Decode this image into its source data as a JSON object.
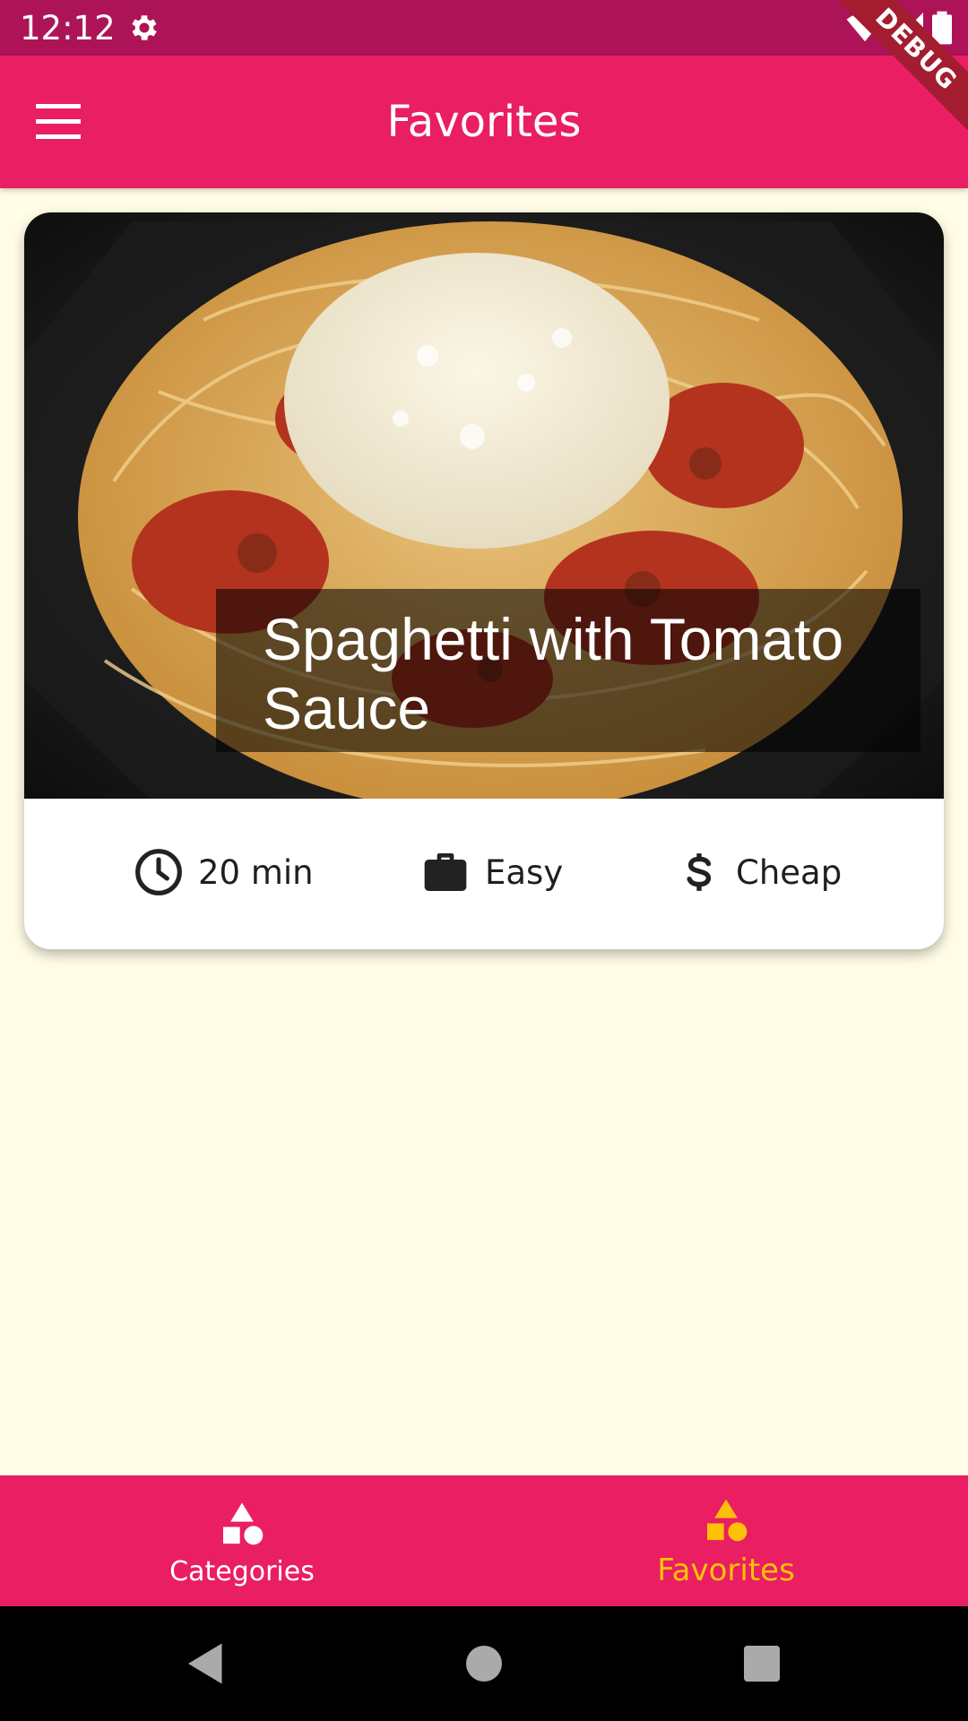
{
  "status_bar": {
    "time": "12:12",
    "icons": [
      "gear-icon",
      "wifi-icon",
      "signal-icon",
      "battery-icon"
    ]
  },
  "debug_banner": "DEBUG",
  "app_bar": {
    "title": "Favorites",
    "menu_icon": "menu-icon"
  },
  "meal_card": {
    "title": "Spaghetti with Tomato Sauce",
    "image_icon": "spaghetti-photo",
    "duration": "20 min",
    "complexity": "Easy",
    "affordability": "Cheap",
    "duration_icon": "clock-icon",
    "complexity_icon": "briefcase-icon",
    "affordability_icon": "dollar-icon"
  },
  "bottom_nav": {
    "items": [
      {
        "label": "Categories",
        "icon": "category-icon",
        "active": false
      },
      {
        "label": "Favorites",
        "icon": "category-icon",
        "active": true
      }
    ]
  },
  "system_nav": [
    "back-icon",
    "home-icon",
    "recents-icon"
  ],
  "colors": {
    "primary": "#e91e63",
    "status_bar": "#ad1457",
    "accent": "#ffc107",
    "background": "#fffde6"
  }
}
